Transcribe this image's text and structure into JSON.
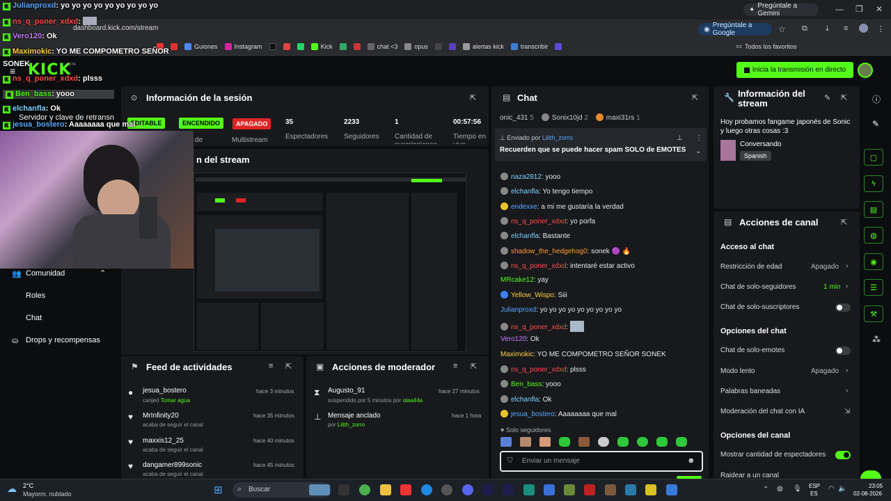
{
  "browser": {
    "url": "dashboard.kick.com/stream",
    "gemini_label": "Pregúntale a Gemini",
    "ask_google_label": "Pregúntale a Google",
    "bookmarks": [
      "Guiones",
      "Instagram",
      "Kick",
      "chat <3",
      "opus",
      "alertas kick",
      "transcribir"
    ],
    "all_favorites": "Todos los favoritos"
  },
  "kick": {
    "logo": "KICK",
    "beta": "BETA",
    "go_live": "Inicia la transmisión en directo"
  },
  "session": {
    "title": "Información de la sesión",
    "pills": [
      "EDITABLE",
      "ENCENDIDO",
      "APAGADO"
    ],
    "pill_labels": [
      "esos de",
      "Multistream"
    ],
    "stats": [
      {
        "value": "35",
        "label": "Espectadores"
      },
      {
        "value": "2233",
        "label": "Seguidores"
      },
      {
        "value": "1",
        "label": "Cantidad de suscripciones"
      },
      {
        "value": "00:57:56",
        "label": "Tiempo en vivo"
      }
    ],
    "preview_title": "n del stream"
  },
  "nav": {
    "comunidad": "Comunidad",
    "roles": "Roles",
    "chat": "Chat",
    "drops": "Drops y recompensas"
  },
  "activity": {
    "title": "Feed de actividades",
    "items": [
      {
        "name": "jesua_bostero",
        "sub": "canjeó",
        "sub2": "Tomar agua",
        "time": "hace 3 minutos"
      },
      {
        "name": "MrInfinity20",
        "sub": "acaba de seguir el canal",
        "time": "hace 35 minutos"
      },
      {
        "name": "maxxis12_25",
        "sub": "acaba de seguir el canal",
        "time": "hace 40 minutos"
      },
      {
        "name": "dangamer899sonic",
        "sub": "acaba de seguir el canal",
        "time": "hace 45 minutos"
      }
    ]
  },
  "moderator": {
    "title": "Acciones de moderador",
    "items": [
      {
        "name": "Augusto_91",
        "sub": "suspendido por 5 minutos por",
        "sub2": "olaa44a",
        "time": "hace 27 minutos"
      },
      {
        "name": "Mensaje anclado",
        "sub": "por",
        "sub2": "Lilith_zorro",
        "time": "hace 1 hora"
      }
    ]
  },
  "chat": {
    "title": "Chat",
    "top_users": [
      {
        "name": "onic_431",
        "count": "5"
      },
      {
        "name": "Sonix10jd",
        "count": "2"
      },
      {
        "name": "maxi31rs",
        "count": "1"
      }
    ],
    "pinned_by_label": "Enviado por",
    "pinned_by": "Lilith_zorro",
    "pinned_text": "Recuerden que se puede hacer spam SOLO de EMOTES",
    "messages": [
      {
        "user": "naza2812",
        "text": "yooo",
        "color": "#7fd3ff"
      },
      {
        "user": "elchanfla",
        "text": "Yo tengo tiempo",
        "color": "#7fd3ff"
      },
      {
        "user": "endexxe",
        "text": "a mi me gustaría la verdad",
        "color": "#5aa8ff"
      },
      {
        "user": "ns_q_poner_xdxd",
        "text": "yo porfa",
        "color": "#ff4d4d"
      },
      {
        "user": "elchanfla",
        "text": "Bastante",
        "color": "#7fd3ff"
      },
      {
        "user": "shadow_the_hedgehog0",
        "text": "sonek 🟣 🔥",
        "color": "#ff9b2f"
      },
      {
        "user": "ns_q_poner_xdxd",
        "text": "intentaré estar activo",
        "color": "#ff4d4d"
      },
      {
        "user": "MRcake12",
        "text": "yay",
        "color": "#53fc18"
      },
      {
        "user": "Yellow_Wispo",
        "text": "Siii",
        "color": "#ffd23f"
      },
      {
        "user": "Julianproxd",
        "text": "yo yo yo yo yo yo yo yo yo",
        "color": "#5aa8ff"
      },
      {
        "user": "ns_q_poner_xdxd",
        "text": "",
        "color": "#ff4d4d"
      },
      {
        "user": "Vero120",
        "text": "Ok",
        "color": "#c77dff"
      },
      {
        "user": "Maximokic",
        "text": "YO ME COMPOMETRO SEÑOR SONEK",
        "color": "#ffd23f"
      },
      {
        "user": "ns_q_poner_xdxd",
        "text": "plsss",
        "color": "#ff4d4d"
      },
      {
        "user": "Ben_bass",
        "text": "yooo",
        "color": "#53fc18"
      },
      {
        "user": "elchanfla",
        "text": "Ok",
        "color": "#7fd3ff"
      },
      {
        "user": "jesua_bostero",
        "text": "Aaaaaaaa que mal",
        "color": "#5aa8ff"
      }
    ],
    "followers_only": "Solo seguidores",
    "input_placeholder": "Enviar un mensaje"
  },
  "stream_info": {
    "title": "Información del stream",
    "description": "Hoy probamos fangame japonés de Sonic y luego otras cosas :3",
    "category": "Conversando",
    "language": "Spanish"
  },
  "channel_actions": {
    "title": "Acciones de canal",
    "chat_access": "Acceso al chat",
    "age_restriction": "Restricción de edad",
    "age_value": "Apagado",
    "followers_only": "Chat de solo-seguidores",
    "followers_value": "1 min",
    "subs_only": "Chat de solo-suscriptores",
    "chat_options": "Opciones del chat",
    "emotes_only": "Chat de solo-emotes",
    "slow_mode": "Modo lento",
    "slow_value": "Apagado",
    "banned_words": "Palabras baneadas",
    "ai_moderation": "Moderación del chat con IA",
    "channel_options": "Opciones del canal",
    "show_viewers": "Mostrar cantidad de espectadores",
    "raid": "Raidear a un canal"
  },
  "overlay_chat": [
    {
      "user": "Julianproxd",
      "text": "yo yo yo yo yo yo yo yo yo",
      "color": "#5aa8ff"
    },
    {
      "user": "ns_q_poner_xdxd",
      "text": "",
      "color": "#ff4d4d"
    },
    {
      "user": "Vero120",
      "text": "Ok",
      "color": "#c77dff"
    },
    {
      "user": "Maximokic",
      "text": "YO ME COMPOMETRO SEÑOR",
      "color": "#ffd23f"
    },
    {
      "user": "SONEK",
      "text": "",
      "color": "#ffffff"
    },
    {
      "user": "ns_q_poner_xdxd",
      "text": "plsss",
      "color": "#ff4d4d"
    },
    {
      "user": "Ben_bass",
      "text": "yooo",
      "color": "#53fc18"
    },
    {
      "user": "elchanfla",
      "text": "Ok",
      "color": "#7fd3ff"
    },
    {
      "user": "Servidor y clave de retransn",
      "text": "",
      "color": "#ffffff"
    },
    {
      "user": "jesua_bostero",
      "text": "Aaaaaaaa que mal",
      "color": "#5aa8ff"
    }
  ],
  "taskbar": {
    "weather_temp": "2°C",
    "weather_desc": "Mayorm. nublado",
    "search": "Buscar",
    "lang1": "ESP",
    "lang2": "ES",
    "time": "23:05",
    "date": "02-08-2026"
  }
}
